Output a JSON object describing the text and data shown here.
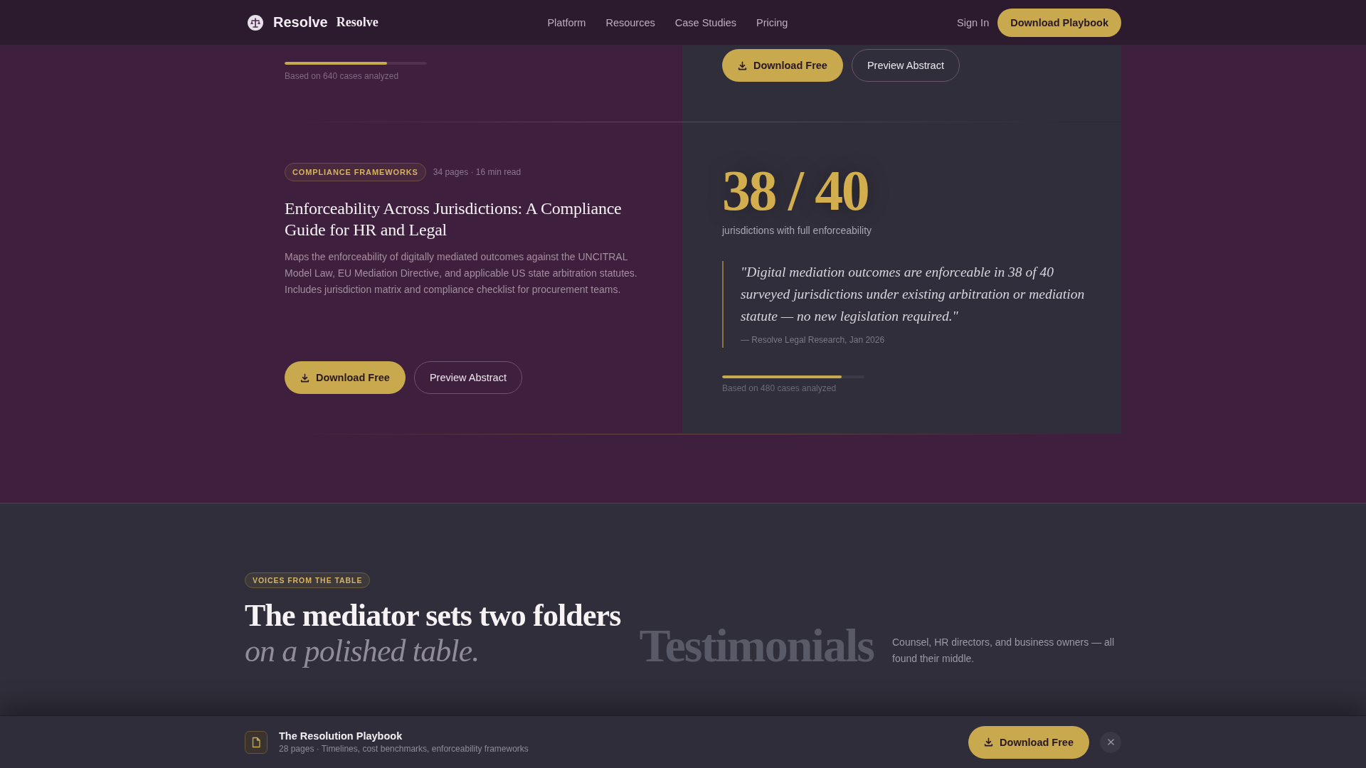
{
  "nav": {
    "brand": {
      "name": "Resolve",
      "wordmark": "Resolve"
    },
    "links": [
      {
        "label": "Platform"
      },
      {
        "label": "Resources"
      },
      {
        "label": "Case Studies"
      },
      {
        "label": "Pricing"
      }
    ],
    "sign_in": "Sign In",
    "cta": "Download Playbook"
  },
  "resources": [
    {
      "kind": "reversed",
      "level": 0.72,
      "sample_note": "Based on 640 cases analyzed",
      "actions": [
        {
          "kind": "primary",
          "label": "Download Free"
        },
        {
          "kind": "secondary",
          "label": "Preview Abstract"
        }
      ]
    },
    {
      "kind": "standard",
      "tag": "COMPLIANCE FRAMEWORKS",
      "meta": "34 pages · 16 min read",
      "title": "Enforceability Across Jurisdictions: A Compliance Guide for HR and Legal",
      "summary": "Maps the enforceability of digitally mediated outcomes against the UNCITRAL Model Law, EU Mediation Directive, and applicable US state arbitration statutes. Includes jurisdiction matrix and compliance checklist for procurement teams.",
      "actions": [
        {
          "kind": "primary",
          "label": "Download Free"
        },
        {
          "kind": "secondary",
          "label": "Preview Abstract"
        }
      ],
      "stat": "38 / 40",
      "stat_caption": "jurisdictions with full enforceability",
      "quote": "\"Digital mediation outcomes are enforceable in 38 of 40 surveyed jurisdictions under existing arbitration or mediation statute — no new legislation required.\"",
      "quote_source": "— Resolve Legal Research, Jan 2026",
      "level": 0.84,
      "sample_note": "Based on 480 cases analyzed"
    }
  ],
  "testimonials": {
    "eyebrow": "VOICES FROM THE TABLE",
    "heading": "The mediator sets two folders",
    "heading_accent": "on a polished table.",
    "backdrop_word": "Testimonials",
    "intro": "Counsel, HR directors, and business owners — all found their middle."
  },
  "playbook_bar": {
    "title": "The Resolution Playbook",
    "details": "28 pages · Timelines, cost benchmarks, enforceability frameworks",
    "action": "Download Free"
  }
}
